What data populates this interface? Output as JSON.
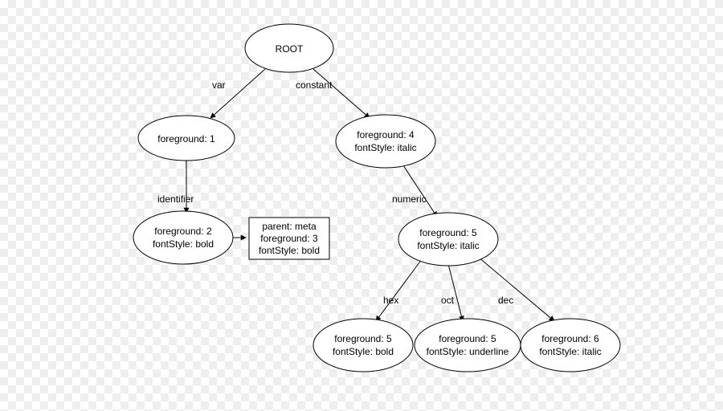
{
  "diagram": {
    "root_label": "ROOT",
    "edges": {
      "root_var": "var",
      "root_constant": "constant",
      "var_identifier": "identifier",
      "constant_numeric": "numeric",
      "numeric_hex": "hex",
      "numeric_oct": "oct",
      "numeric_dec": "dec"
    },
    "nodes": {
      "var": {
        "line1": "foreground: 1"
      },
      "constant": {
        "line1": "foreground: 4",
        "line2": "fontStyle: italic"
      },
      "identifier": {
        "line1": "foreground: 2",
        "line2": "fontStyle: bold"
      },
      "meta_box": {
        "line1": "parent: meta",
        "line2": "foreground: 3",
        "line3": "fontStyle: bold"
      },
      "numeric": {
        "line1": "foreground: 5",
        "line2": "fontStyle: italic"
      },
      "hex": {
        "line1": "foreground: 5",
        "line2": "fontStyle: bold"
      },
      "oct": {
        "line1": "foreground: 5",
        "line2": "fontStyle: underline"
      },
      "dec": {
        "line1": "foreground: 6",
        "line2": "fontStyle: italic"
      }
    }
  }
}
